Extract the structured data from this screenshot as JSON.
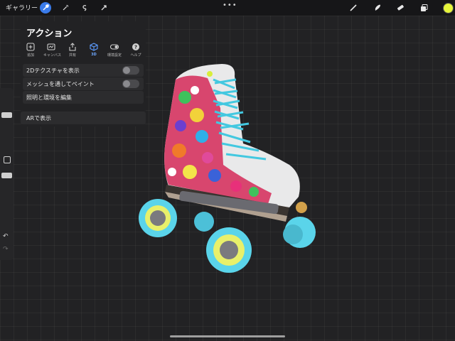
{
  "topbar": {
    "gallery_label": "ギャラリー",
    "more": "•••",
    "tools_left": [
      "wrench-icon",
      "magic-wand-icon",
      "selection-icon",
      "move-icon"
    ],
    "tools_right": [
      "brush-icon",
      "smudge-icon",
      "eraser-icon",
      "layers-icon"
    ],
    "current_color": "#e6f53a"
  },
  "panel": {
    "title": "アクション",
    "tabs": [
      {
        "label": "追加",
        "icon": "add-icon"
      },
      {
        "label": "キャンバス",
        "icon": "canvas-icon"
      },
      {
        "label": "共有",
        "icon": "share-icon"
      },
      {
        "label": "3D",
        "icon": "cube-icon",
        "active": true
      },
      {
        "label": "環境設定",
        "icon": "toggle-prefs-icon"
      },
      {
        "label": "ヘルプ",
        "icon": "help-icon"
      }
    ],
    "rows": {
      "show_2d_texture": "2Dテクスチャを表示",
      "paint_through_mesh": "メッシュを通してペイント",
      "edit_lighting": "照明と環境を編集",
      "view_ar": "ARで表示"
    }
  },
  "sidebar": {
    "undo": "↶",
    "redo": "↷"
  },
  "accent_color": "#3a7bea"
}
